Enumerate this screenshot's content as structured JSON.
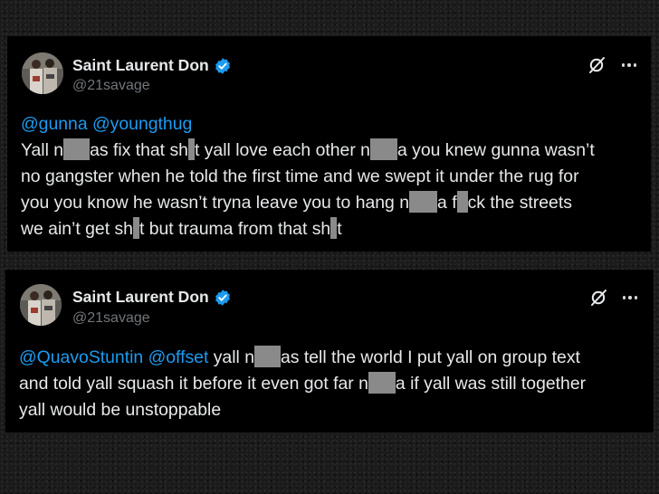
{
  "colors": {
    "card_background": "#000000",
    "text": "#e7e9ea",
    "muted": "#71767b",
    "mention": "#1d9bf0",
    "verified_badge": "#1d9bf0",
    "censor_block": "#8a8a8a"
  },
  "tweets": [
    {
      "author": {
        "display_name": "Saint Laurent Don",
        "handle": "@21savage",
        "verified_icon": "verified-badge-icon",
        "avatar_icon": "profile-photo"
      },
      "actions": {
        "grok_icon": "grok-icon",
        "more_icon": "more-horizontal-icon"
      },
      "mentions": [
        "@gunna",
        "@youngthug"
      ],
      "lines": [
        [
          "Yall n",
          "as fix that sh",
          "t yall love each other n",
          "a you knew gunna wasn’t"
        ],
        [
          "no gangster when he told the first time and we swept it under the rug for"
        ],
        [
          "you you know he wasn’t tryna leave you to hang n",
          "a f",
          "ck the streets"
        ],
        [
          "we ain’t get sh",
          "t but trauma from that sh",
          "t"
        ]
      ]
    },
    {
      "author": {
        "display_name": "Saint Laurent Don",
        "handle": "@21savage",
        "verified_icon": "verified-badge-icon",
        "avatar_icon": "profile-photo"
      },
      "actions": {
        "grok_icon": "grok-icon",
        "more_icon": "more-horizontal-icon"
      },
      "mentions": [
        "@QuavoStuntin",
        "@offset"
      ],
      "lines": [
        [
          "yall n",
          "as tell the world I put yall on group text"
        ],
        [
          "and told yall squash it before it even got far n",
          "a if yall was still together"
        ],
        [
          "yall would be unstoppable"
        ]
      ]
    }
  ]
}
